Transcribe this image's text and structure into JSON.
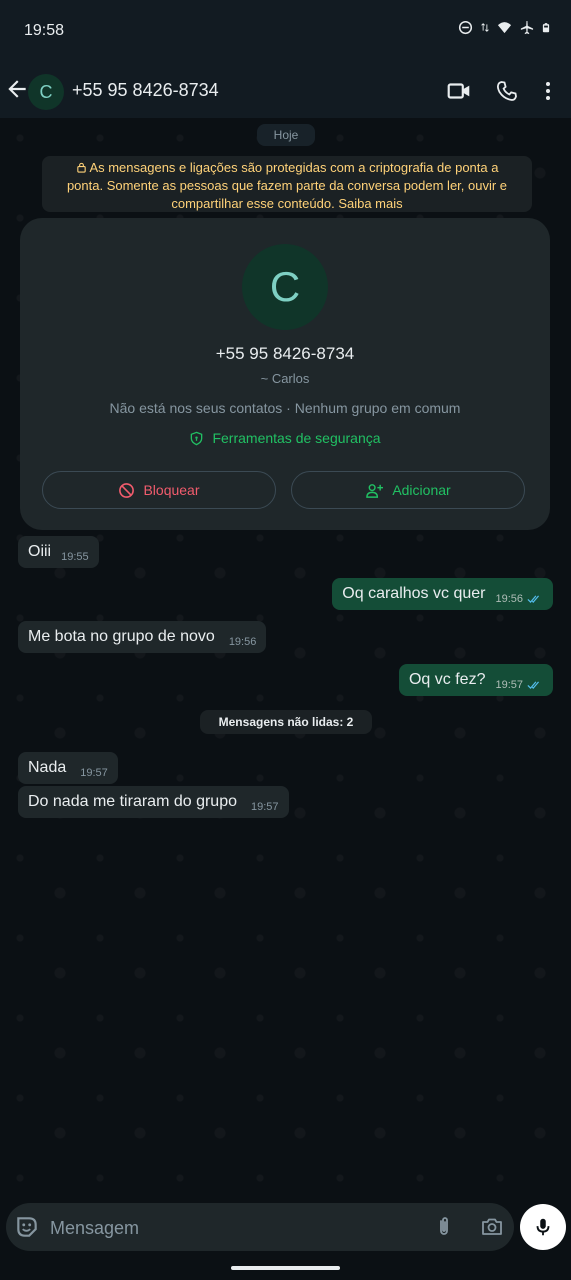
{
  "status_bar": {
    "time": "19:58",
    "icons": [
      "do-not-disturb-icon",
      "data-arrows-icon",
      "wifi-icon",
      "airplane-icon",
      "battery-icon"
    ]
  },
  "header": {
    "avatar_letter": "C",
    "title": "+55 95 8426-8734",
    "icons": [
      "back-arrow-icon",
      "video-call-icon",
      "phone-icon",
      "more-vert-icon"
    ]
  },
  "date_chip": "Hoje",
  "encryption_notice": {
    "line1": "As mensagens e ligações são protegidas com a criptografia de ponta a",
    "line2": "ponta. Somente as pessoas que fazem parte da conversa podem ler, ouvir e",
    "line3_text": "compartilhar esse conteúdo.",
    "line3_link": "Saiba mais"
  },
  "contact_card": {
    "avatar_letter": "C",
    "phone": "+55 95 8426-8734",
    "name": "~ Carlos",
    "info": "Não está nos seus contatos · Nenhum grupo em comum",
    "security_label": "Ferramentas de segurança",
    "block_label": "Bloquear",
    "add_label": "Adicionar"
  },
  "messages": [
    {
      "direction": "in",
      "text": "Oiii",
      "time": "19:55"
    },
    {
      "direction": "out",
      "text": "Oq caralhos vc quer",
      "time": "19:56",
      "status": "read"
    },
    {
      "direction": "in",
      "text": "Me bota no grupo de novo",
      "time": "19:56"
    },
    {
      "direction": "out",
      "text": "Oq vc fez?",
      "time": "19:57",
      "status": "read"
    },
    {
      "direction": "in",
      "text": "Nada",
      "time": "19:57"
    },
    {
      "direction": "in",
      "text": "Do nada me tiraram do grupo",
      "time": "19:57"
    }
  ],
  "unread_chip": "Mensagens não lidas: 2",
  "composer": {
    "placeholder": "Mensagem",
    "icons": [
      "emoji-icon",
      "attach-icon",
      "camera-icon",
      "mic-icon"
    ]
  },
  "colors": {
    "background": "#0b1014",
    "incoming_bubble": "#1f272a",
    "outgoing_bubble": "#144d37",
    "accent_green": "#21c063",
    "block_red": "#f15c6d",
    "notice_yellow": "#ffd279",
    "read_ticks": "#53bdeb"
  }
}
